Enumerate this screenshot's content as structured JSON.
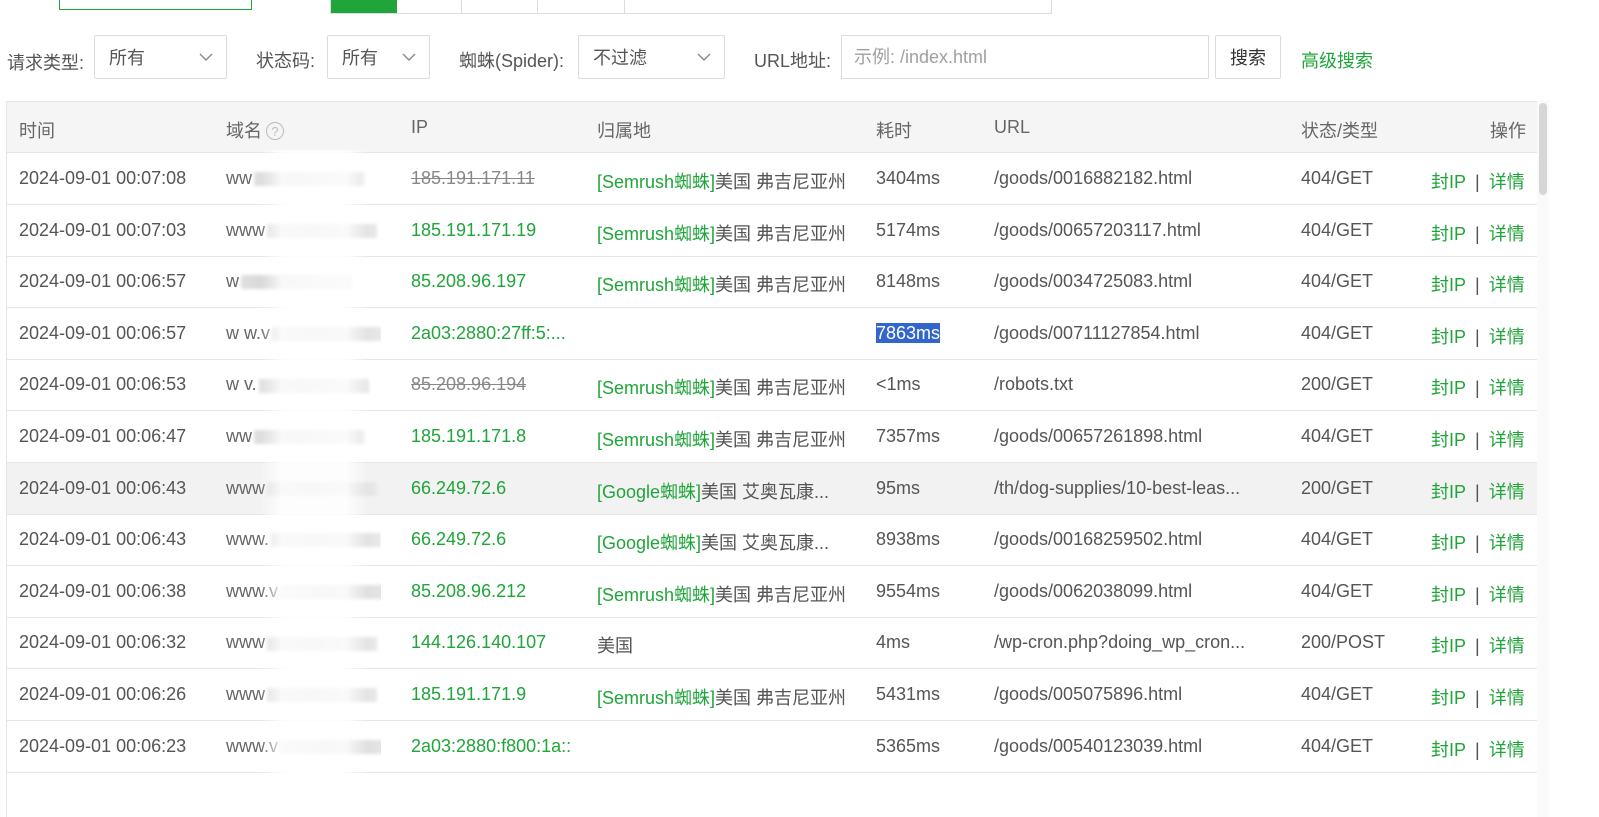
{
  "filters": {
    "request_type_label": "请求类型:",
    "request_type_value": "所有",
    "status_code_label": "状态码:",
    "status_code_value": "所有",
    "spider_label": "蜘蛛(Spider):",
    "spider_value": "不过滤",
    "url_label": "URL地址:",
    "url_placeholder": "示例: /index.html",
    "search_button": "搜索",
    "advanced_search": "高级搜索"
  },
  "table": {
    "headers": {
      "time": "时间",
      "domain": "域名",
      "domain_help": "?",
      "ip": "IP",
      "location": "归属地",
      "cost": "耗时",
      "url": "URL",
      "status": "状态/类型",
      "ops": "操作"
    },
    "ops": {
      "ban": "封IP",
      "sep": "|",
      "detail": "详情"
    },
    "rows": [
      {
        "time": "2024-09-01 00:07:08",
        "domain": "ww",
        "ip": "185.191.171.11",
        "spider": "[Semrush蜘蛛]",
        "location": "美国 弗吉尼亚州",
        "cost": "3404ms",
        "url": "/goods/0016882182.html",
        "status": "404/GET"
      },
      {
        "time": "2024-09-01 00:07:03",
        "domain": "www",
        "ip": "185.191.171.19",
        "spider": "[Semrush蜘蛛]",
        "location": "美国 弗吉尼亚州",
        "cost": "5174ms",
        "url": "/goods/00657203117.html",
        "status": "404/GET"
      },
      {
        "time": "2024-09-01 00:06:57",
        "domain": "w",
        "ip": "85.208.96.197",
        "spider": "[Semrush蜘蛛]",
        "location": "美国 弗吉尼亚州",
        "cost": "8148ms",
        "url": "/goods/0034725083.html",
        "status": "404/GET"
      },
      {
        "time": "2024-09-01 00:06:57",
        "domain": "w  w.v",
        "ip": "2a03:2880:27ff:5:...",
        "spider": "",
        "location": "",
        "cost": "7863ms",
        "url": "/goods/00711127854.html",
        "status": "404/GET"
      },
      {
        "time": "2024-09-01 00:06:53",
        "domain": "w  v.",
        "ip": "85.208.96.194",
        "spider": "[Semrush蜘蛛]",
        "location": "美国 弗吉尼亚州",
        "cost": "<1ms",
        "url": "/robots.txt",
        "status": "200/GET"
      },
      {
        "time": "2024-09-01 00:06:47",
        "domain": "ww",
        "ip": "185.191.171.8",
        "spider": "[Semrush蜘蛛]",
        "location": "美国 弗吉尼亚州",
        "cost": "7357ms",
        "url": "/goods/00657261898.html",
        "status": "404/GET"
      },
      {
        "time": "2024-09-01 00:06:43",
        "domain": "www",
        "ip": "66.249.72.6",
        "spider": "[Google蜘蛛]",
        "location": "美国 艾奥瓦康...",
        "cost": "95ms",
        "url": "/th/dog-supplies/10-best-leas...",
        "status": "200/GET"
      },
      {
        "time": "2024-09-01 00:06:43",
        "domain": "www.",
        "ip": "66.249.72.6",
        "spider": "[Google蜘蛛]",
        "location": "美国 艾奥瓦康...",
        "cost": "8938ms",
        "url": "/goods/00168259502.html",
        "status": "404/GET"
      },
      {
        "time": "2024-09-01 00:06:38",
        "domain": "www.v",
        "ip": "85.208.96.212",
        "spider": "[Semrush蜘蛛]",
        "location": "美国 弗吉尼亚州",
        "cost": "9554ms",
        "url": "/goods/0062038099.html",
        "status": "404/GET"
      },
      {
        "time": "2024-09-01 00:06:32",
        "domain": "www",
        "ip": "144.126.140.107",
        "spider": "",
        "location": "美国",
        "cost": "4ms",
        "url": "/wp-cron.php?doing_wp_cron...",
        "status": "200/POST"
      },
      {
        "time": "2024-09-01 00:06:26",
        "domain": "www",
        "ip": "185.191.171.9",
        "spider": "[Semrush蜘蛛]",
        "location": "美国 弗吉尼亚州",
        "cost": "5431ms",
        "url": "/goods/005075896.html",
        "status": "404/GET"
      },
      {
        "time": "2024-09-01 00:06:23",
        "domain": "www.v",
        "ip": "2a03:2880:f800:1a::",
        "spider": "",
        "location": "",
        "cost": "5365ms",
        "url": "/goods/00540123039.html",
        "status": "404/GET"
      }
    ]
  },
  "colors": {
    "accent": "#20a53a",
    "selection": "#3366cc",
    "row_highlight": "#f2f2f2"
  },
  "icons": [
    "chevron-down-icon",
    "help-icon"
  ]
}
